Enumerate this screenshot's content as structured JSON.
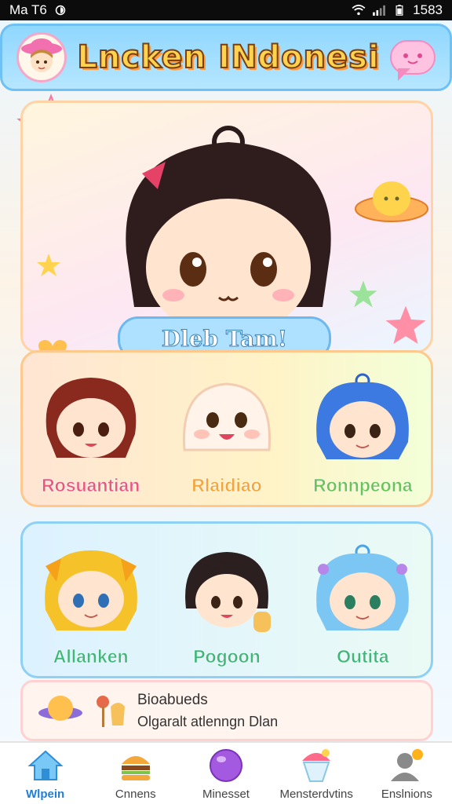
{
  "status_bar": {
    "left_text": "Ma T6",
    "time": "1583"
  },
  "header": {
    "title": "Lncken INdonesi"
  },
  "hero": {
    "caption": "Dleb Tam!"
  },
  "characters_row1": [
    {
      "name": "Rosuantian",
      "color": "#e8577e"
    },
    {
      "name": "Rlaidiao",
      "color": "#f2a53a"
    },
    {
      "name": "Ronnpeona",
      "color": "#6ac35a"
    }
  ],
  "characters_row2": [
    {
      "name": "Allanken",
      "color": "#3fb67a"
    },
    {
      "name": "Pogoon",
      "color": "#3fb67a"
    },
    {
      "name": "Outita",
      "color": "#3fb67a"
    }
  ],
  "banner": {
    "title": "Bioabueds",
    "subtitle": "Olgaralt atlenngn Dlan"
  },
  "tabs": [
    {
      "label": "Wlpein",
      "icon": "home-icon",
      "active": true
    },
    {
      "label": "Cnnens",
      "icon": "burger-icon",
      "active": false
    },
    {
      "label": "Minesset",
      "icon": "purple-ball-icon",
      "active": false
    },
    {
      "label": "Mensterdvtins",
      "icon": "shaved-ice-icon",
      "active": false
    },
    {
      "label": "Enslnions",
      "icon": "profile-icon",
      "active": false
    }
  ],
  "colors": {
    "accent": "#6ec1f5",
    "title_fill": "#ffd34d",
    "active_tab": "#1f7ed8"
  }
}
